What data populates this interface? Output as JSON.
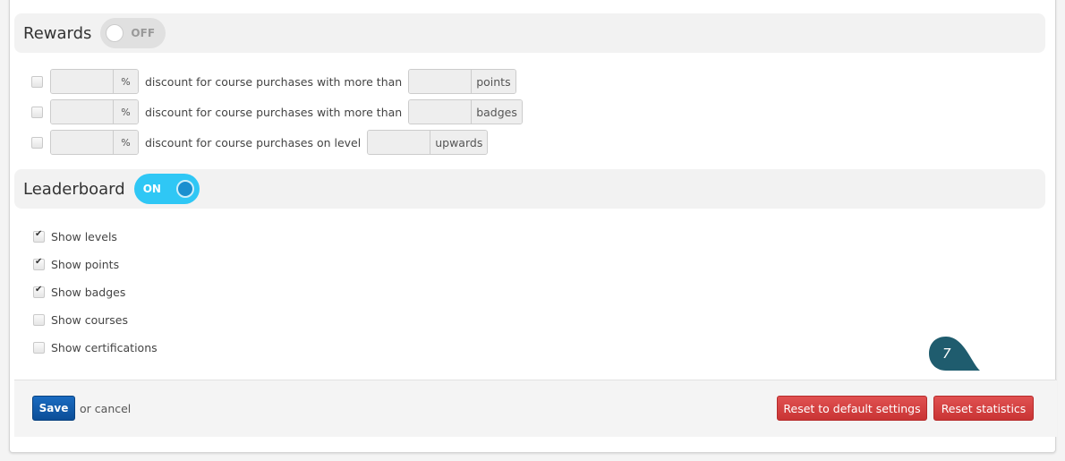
{
  "rewards": {
    "title": "Rewards",
    "toggle_label": "OFF",
    "rows": [
      {
        "percent_unit": "%",
        "label": "discount for course purchases with more than",
        "unit": "points"
      },
      {
        "percent_unit": "%",
        "label": "discount for course purchases with more than",
        "unit": "badges"
      },
      {
        "percent_unit": "%",
        "label": "discount for course purchases on level",
        "unit": "upwards"
      }
    ]
  },
  "leaderboard": {
    "title": "Leaderboard",
    "toggle_label": "ON",
    "options": [
      {
        "label": "Show levels",
        "checked": true
      },
      {
        "label": "Show points",
        "checked": true
      },
      {
        "label": "Show badges",
        "checked": true
      },
      {
        "label": "Show courses",
        "checked": false
      },
      {
        "label": "Show certifications",
        "checked": false
      }
    ]
  },
  "footer": {
    "save_label": "Save",
    "or_text": "or",
    "cancel_label": "cancel",
    "reset_default_label": "Reset to default settings",
    "reset_stats_label": "Reset statistics"
  },
  "marker": {
    "number": "7",
    "color": "#1f5c6e"
  }
}
